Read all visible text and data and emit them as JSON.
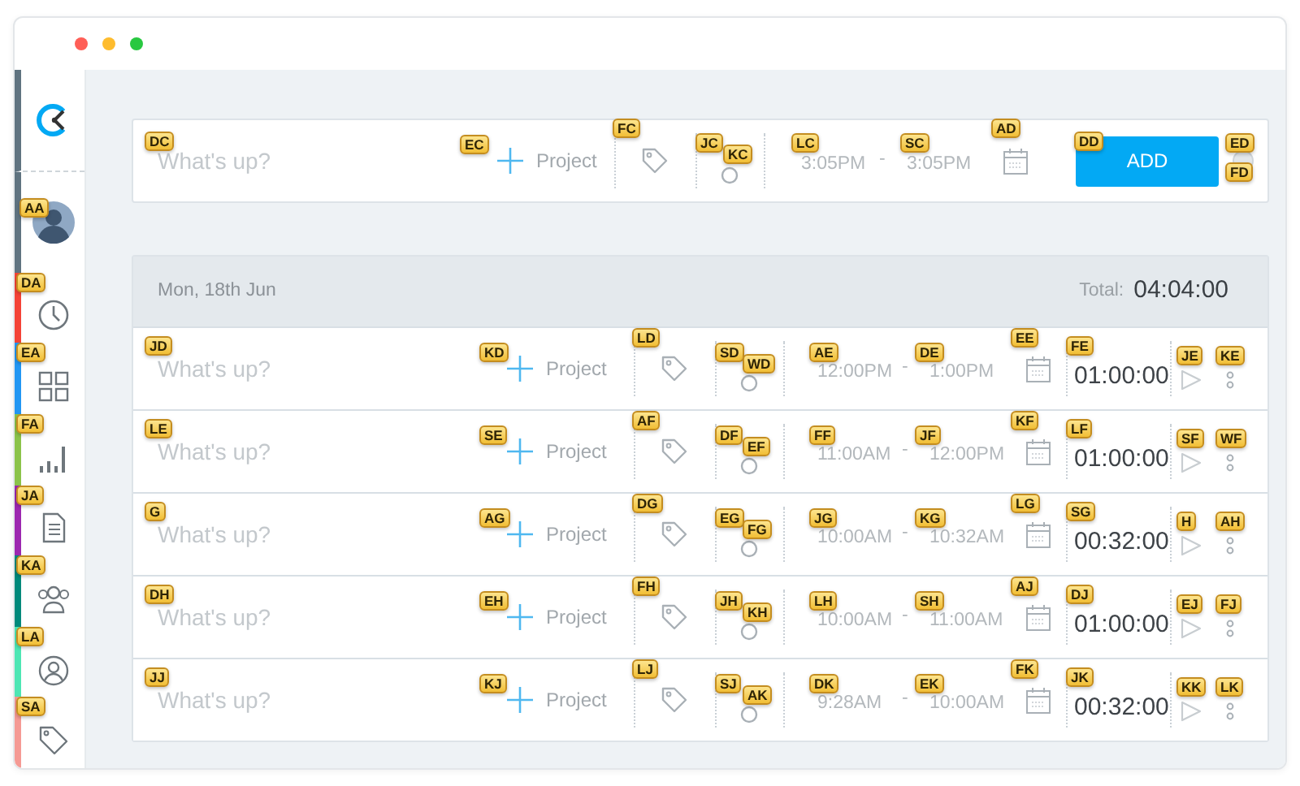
{
  "window": {
    "controls": [
      {
        "color": "#ff5f57"
      },
      {
        "color": "#febc2e"
      },
      {
        "color": "#28c840"
      }
    ]
  },
  "sidebar": {
    "avatar": {
      "hint": "AA"
    },
    "items": [
      {
        "hint": "DA",
        "color": "#f44336"
      },
      {
        "hint": "EA",
        "color": "#2196f3"
      },
      {
        "hint": "FA",
        "color": "#8bc34a"
      },
      {
        "hint": "JA",
        "color": "#9c27b0"
      },
      {
        "hint": "KA",
        "color": "#00897b"
      },
      {
        "hint": "LA",
        "color": "#4ee6b4"
      },
      {
        "hint": "SA",
        "color": "#f59a94"
      }
    ]
  },
  "timer": {
    "description": {
      "placeholder": "What's up?",
      "hint": "DC"
    },
    "project": {
      "label": "Project",
      "hint": "EC"
    },
    "tag_hint": "FC",
    "billable_hints": [
      "JC",
      "KC"
    ],
    "start": {
      "time": "3:05PM",
      "hint": "LC"
    },
    "separator": "-",
    "end": {
      "time": "3:05PM",
      "hint": "SC"
    },
    "calendar_hint": "AD",
    "add_button": {
      "label": "ADD",
      "hint": "DD"
    },
    "mode_hints": [
      "ED",
      "FD"
    ]
  },
  "day_group": {
    "date": "Mon, 18th Jun",
    "total_label": "Total:",
    "total": "04:04:00"
  },
  "entries": [
    {
      "description": {
        "placeholder": "What's up?",
        "hint": "JD"
      },
      "project": {
        "label": "Project",
        "hint": "KD"
      },
      "tag_hint": "LD",
      "billable_hints": [
        "SD",
        "WD"
      ],
      "start": {
        "time": "12:00PM",
        "hint": "AE"
      },
      "separator": "-",
      "end": {
        "time": "1:00PM",
        "hint": "DE"
      },
      "calendar_hint": "EE",
      "duration": {
        "text": "01:00:00",
        "hint": "FE"
      },
      "play_hint": "JE",
      "menu_hint": "KE"
    },
    {
      "description": {
        "placeholder": "What's up?",
        "hint": "LE"
      },
      "project": {
        "label": "Project",
        "hint": "SE"
      },
      "tag_hint": "AF",
      "billable_hints": [
        "DF",
        "EF"
      ],
      "start": {
        "time": "11:00AM",
        "hint": "FF"
      },
      "separator": "-",
      "end": {
        "time": "12:00PM",
        "hint": "JF"
      },
      "calendar_hint": "KF",
      "duration": {
        "text": "01:00:00",
        "hint": "LF"
      },
      "play_hint": "SF",
      "menu_hint": "WF"
    },
    {
      "description": {
        "placeholder": "What's up?",
        "hint": "G"
      },
      "project": {
        "label": "Project",
        "hint": "AG"
      },
      "tag_hint": "DG",
      "billable_hints": [
        "EG",
        "FG"
      ],
      "start": {
        "time": "10:00AM",
        "hint": "JG"
      },
      "separator": "-",
      "end": {
        "time": "10:32AM",
        "hint": "KG"
      },
      "calendar_hint": "LG",
      "duration": {
        "text": "00:32:00",
        "hint": "SG"
      },
      "play_hint": "H",
      "menu_hint": "AH"
    },
    {
      "description": {
        "placeholder": "What's up?",
        "hint": "DH"
      },
      "project": {
        "label": "Project",
        "hint": "EH"
      },
      "tag_hint": "FH",
      "billable_hints": [
        "JH",
        "KH"
      ],
      "start": {
        "time": "10:00AM",
        "hint": "LH"
      },
      "separator": "-",
      "end": {
        "time": "11:00AM",
        "hint": "SH"
      },
      "calendar_hint": "AJ",
      "duration": {
        "text": "01:00:00",
        "hint": "DJ"
      },
      "play_hint": "EJ",
      "menu_hint": "FJ"
    },
    {
      "description": {
        "placeholder": "What's up?",
        "hint": "JJ"
      },
      "project": {
        "label": "Project",
        "hint": "KJ"
      },
      "tag_hint": "LJ",
      "billable_hints": [
        "SJ",
        "AK"
      ],
      "start": {
        "time": "9:28AM",
        "hint": "DK"
      },
      "separator": "-",
      "end": {
        "time": "10:00AM",
        "hint": "EK"
      },
      "calendar_hint": "FK",
      "duration": {
        "text": "00:32:00",
        "hint": "JK"
      },
      "play_hint": "KK",
      "menu_hint": "LK"
    }
  ]
}
